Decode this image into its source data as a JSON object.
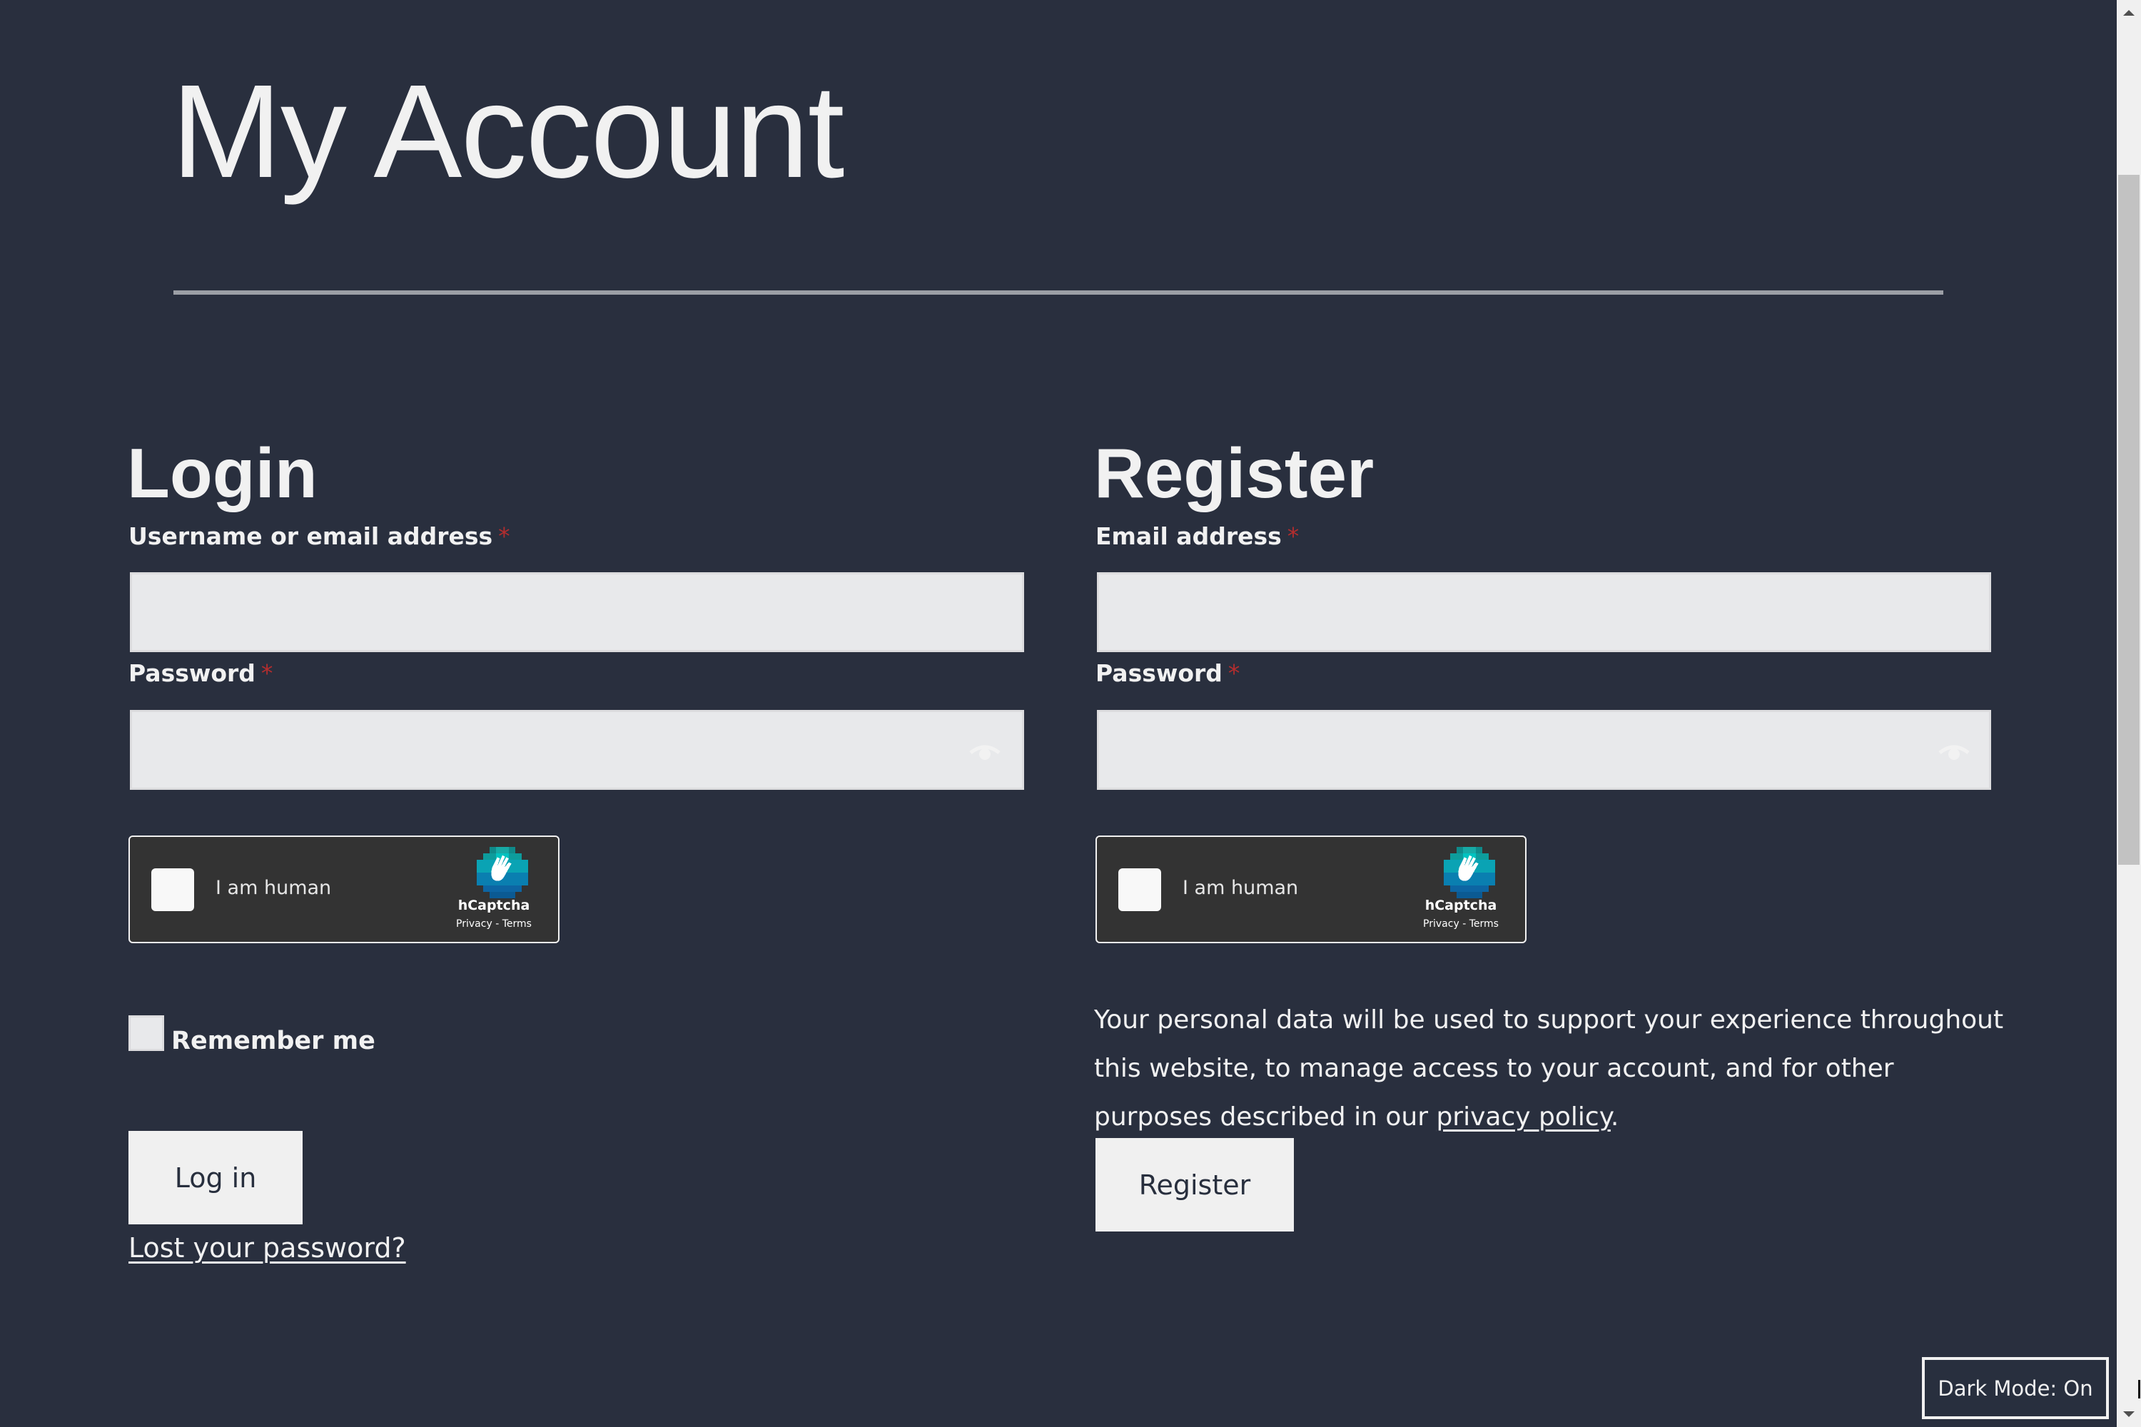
{
  "page": {
    "title": "My Account"
  },
  "login": {
    "heading": "Login",
    "username_label": "Username or email address",
    "username_value": "",
    "password_label": "Password",
    "password_value": "",
    "required_mark": "*",
    "captcha": {
      "label": "I am human",
      "brand": "hCaptcha",
      "privacy_link": "Privacy",
      "separator": " - ",
      "terms_link": "Terms"
    },
    "remember_label": "Remember me",
    "remember_checked": false,
    "submit_label": "Log in",
    "lost_password_link": "Lost your password?"
  },
  "register": {
    "heading": "Register",
    "email_label": "Email address",
    "email_value": "",
    "password_label": "Password",
    "password_value": "",
    "required_mark": "*",
    "captcha": {
      "label": "I am human",
      "brand": "hCaptcha",
      "privacy_link": "Privacy",
      "separator": " - ",
      "terms_link": "Terms"
    },
    "privacy_text_before": "Your personal data will be used to support your experience throughout this website, to manage access to your account, and for other purposes described in our ",
    "privacy_link": "privacy policy",
    "privacy_text_after": ".",
    "submit_label": "Register"
  },
  "dark_mode_toggle": {
    "label": "Dark Mode: On"
  },
  "icons": {
    "password_toggle": "eye-icon",
    "captcha_logo": "hcaptcha-hand-icon",
    "scroll_up": "triangle-up",
    "scroll_down": "triangle-down"
  },
  "colors": {
    "background": "#292f3e",
    "text": "#f1f1f1",
    "input_bg": "#e8e9eb",
    "required": "#b32d2e",
    "button_bg": "#f0f0f0",
    "captcha_bg": "#333333",
    "separator": "#9c9fa6"
  }
}
